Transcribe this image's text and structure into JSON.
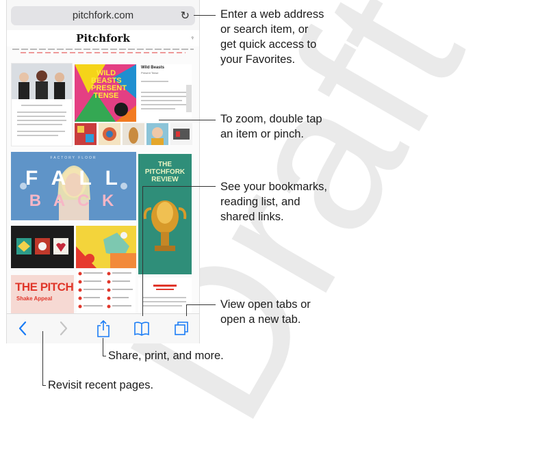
{
  "browser": {
    "url": "pitchfork.com",
    "site_title": "Pitchfork",
    "article_title": "Wild Beasts",
    "article_subtitle": "Present Tense",
    "promo_top_line": "FACTORY FLOOR",
    "promo_main_1": "F A L L",
    "promo_main_2": "B A C K",
    "review_title_1": "THE",
    "review_title_2": "PITCHFORK",
    "review_title_3": "REVIEW",
    "album_art_1": "WILD",
    "album_art_2": "BEASTS",
    "album_art_3": "PRESENT",
    "album_art_4": "TENSE",
    "pitch_title": "THE PITCH",
    "pitch_sub": "Shake Appeal"
  },
  "callouts": {
    "address": "Enter a web address\nor search item, or\nget quick access to\nyour Favorites.",
    "zoom": "To zoom, double tap\nan item or pinch.",
    "bookmarks": "See your bookmarks,\nreading list, and\nshared links.",
    "tabs": "View open tabs or\nopen a new tab.",
    "share": "Share, print, and more.",
    "revisit": "Revisit recent pages."
  },
  "watermark": "Draft",
  "icons": {
    "reload": "reload-icon",
    "back": "back-icon",
    "forward": "forward-icon",
    "share": "share-icon",
    "bookmarks": "bookmarks-icon",
    "tabs": "tabs-icon"
  },
  "colors": {
    "accent": "#1a7cf5",
    "disabled": "#c4c4c4",
    "promo_bg": "#5f94c8",
    "review_bg": "#2f8e79",
    "pitch_red": "#e0362a"
  }
}
